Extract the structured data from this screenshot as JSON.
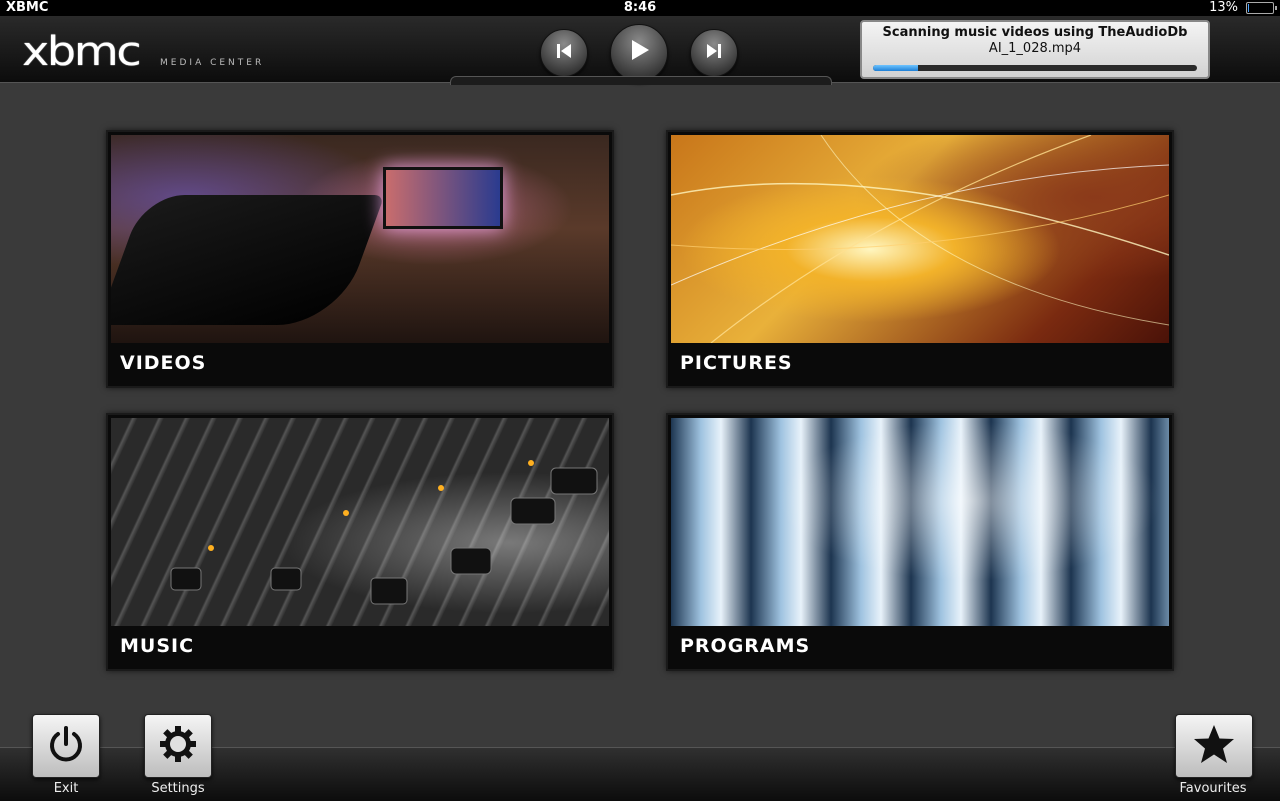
{
  "statusbar": {
    "app_name": "XBMC",
    "time": "8:46",
    "battery_percent": "13%",
    "battery_level": 0.13
  },
  "header": {
    "logo_mark": "xbmc",
    "logo_sub": "MEDIA CENTER",
    "transport": {
      "prev_icon": "skip-previous-icon",
      "play_icon": "play-icon",
      "next_icon": "skip-next-icon"
    },
    "scan_dialog": {
      "title": "Scanning music videos using TheAudioDb",
      "file": "AI_1_028.mp4",
      "progress": 0.14
    }
  },
  "tiles": [
    {
      "label": "VIDEOS"
    },
    {
      "label": "PICTURES"
    },
    {
      "label": "MUSIC"
    },
    {
      "label": "PROGRAMS"
    }
  ],
  "bottom": {
    "exit_label": "Exit",
    "settings_label": "Settings",
    "favourites_label": "Favourites"
  },
  "colors": {
    "background": "#3a3a3a",
    "progress_blue": "#1e7fd6"
  }
}
